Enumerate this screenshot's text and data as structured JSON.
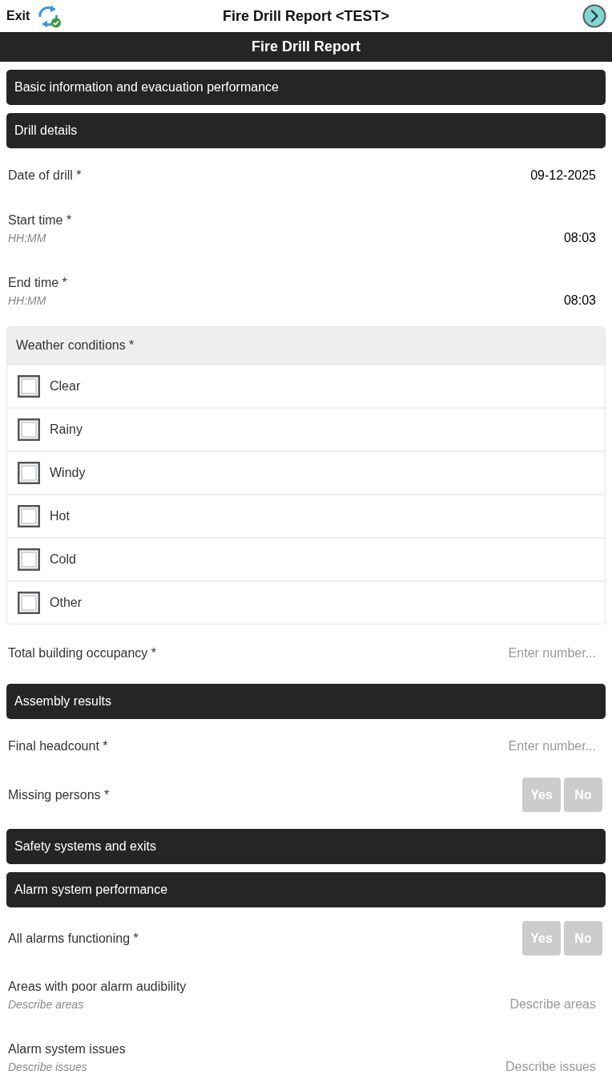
{
  "header": {
    "exit_label": "Exit",
    "title": "Fire Drill Report <TEST>"
  },
  "banner": {
    "title": "Fire Drill Report"
  },
  "items": [
    {
      "kind": "section",
      "title": "Basic information and evacuation performance"
    },
    {
      "kind": "section",
      "title": "Drill details"
    },
    {
      "kind": "field",
      "label": "Date of drill *",
      "value": "09-12-2025"
    },
    {
      "kind": "field",
      "label": "Start time *",
      "hint": "HH:MM",
      "value": "08:03"
    },
    {
      "kind": "field",
      "label": "End time *",
      "hint": "HH:MM",
      "value": "08:03"
    },
    {
      "kind": "checklist",
      "title": "Weather conditions *",
      "options": [
        {
          "label": "Clear",
          "checked": false
        },
        {
          "label": "Rainy",
          "checked": false
        },
        {
          "label": "Windy",
          "checked": false
        },
        {
          "label": "Hot",
          "checked": false
        },
        {
          "label": "Cold",
          "checked": false
        },
        {
          "label": "Other",
          "checked": false
        }
      ]
    },
    {
      "kind": "field",
      "label": "Total building occupancy *",
      "placeholder": "Enter number..."
    },
    {
      "kind": "section",
      "title": "Assembly results"
    },
    {
      "kind": "field",
      "label": "Final headcount *",
      "placeholder": "Enter number..."
    },
    {
      "kind": "yesno",
      "label": "Missing persons *",
      "options": [
        {
          "label": "Yes",
          "selected": false
        },
        {
          "label": "No",
          "selected": false
        }
      ]
    },
    {
      "kind": "section",
      "title": "Safety systems and exits"
    },
    {
      "kind": "section",
      "title": "Alarm system performance"
    },
    {
      "kind": "yesno",
      "label": "All alarms functioning *",
      "options": [
        {
          "label": "Yes",
          "selected": false
        },
        {
          "label": "No",
          "selected": false
        }
      ]
    },
    {
      "kind": "field",
      "label": "Areas with poor alarm audibility",
      "hint": "Describe areas",
      "placeholder": "Describe areas"
    },
    {
      "kind": "field",
      "label": "Alarm system issues",
      "hint": "Describe issues",
      "placeholder": "Describe issues"
    }
  ]
}
